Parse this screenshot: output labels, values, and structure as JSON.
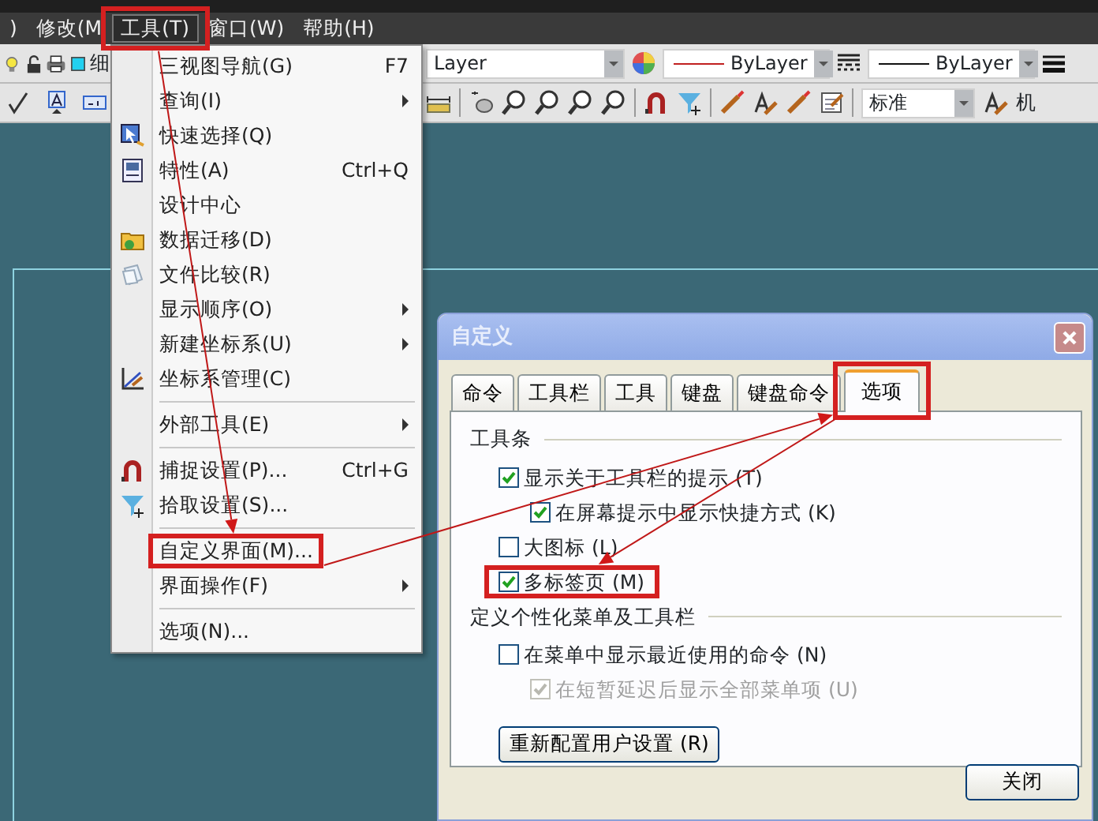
{
  "menubar": {
    "items": [
      {
        "label": ")",
        "selected": false,
        "highlighted": false
      },
      {
        "label": "修改(M",
        "selected": false,
        "highlighted": false
      },
      {
        "label": "工具(T)",
        "selected": true,
        "highlighted": true
      },
      {
        "label": "窗口(W)",
        "selected": false,
        "highlighted": false
      },
      {
        "label": "帮助(H)",
        "selected": false,
        "highlighted": false
      }
    ]
  },
  "toolbar_1": {
    "text_1": "细",
    "layer_combo": {
      "value": "Layer"
    },
    "linetype_combo": {
      "value": "ByLayer"
    },
    "lineweight_combo": {
      "value": "ByLayer"
    }
  },
  "toolbar_2": {
    "style_combo": {
      "value": "标准"
    },
    "text_2": "机"
  },
  "tools_menu": {
    "items": [
      {
        "kind": "item",
        "label": "三视图导航(G)",
        "shortcut": "F7",
        "submenu": false,
        "highlighted": false
      },
      {
        "kind": "item",
        "label": "查询(I)",
        "submenu": true,
        "highlighted": false
      },
      {
        "kind": "item",
        "label": "快速选择(Q)",
        "submenu": false,
        "highlighted": false
      },
      {
        "kind": "item",
        "label": "特性(A)",
        "shortcut": "Ctrl+Q",
        "submenu": false,
        "highlighted": false
      },
      {
        "kind": "item",
        "label": "设计中心",
        "submenu": false,
        "highlighted": false
      },
      {
        "kind": "item",
        "label": "数据迁移(D)",
        "submenu": false,
        "highlighted": false
      },
      {
        "kind": "item",
        "label": "文件比较(R)",
        "submenu": false,
        "highlighted": false
      },
      {
        "kind": "item",
        "label": "显示顺序(O)",
        "submenu": true,
        "highlighted": false
      },
      {
        "kind": "item",
        "label": "新建坐标系(U)",
        "submenu": true,
        "highlighted": false
      },
      {
        "kind": "item",
        "label": "坐标系管理(C)",
        "submenu": false,
        "highlighted": false
      },
      {
        "kind": "separator"
      },
      {
        "kind": "item",
        "label": "外部工具(E)",
        "submenu": true,
        "highlighted": false
      },
      {
        "kind": "separator"
      },
      {
        "kind": "item",
        "label": "捕捉设置(P)...",
        "shortcut": "Ctrl+G",
        "submenu": false,
        "highlighted": false
      },
      {
        "kind": "item",
        "label": "拾取设置(S)...",
        "submenu": false,
        "highlighted": false
      },
      {
        "kind": "separator"
      },
      {
        "kind": "item",
        "label": "自定义界面(M)...",
        "submenu": false,
        "highlighted": true
      },
      {
        "kind": "item",
        "label": "界面操作(F)",
        "submenu": true,
        "highlighted": false
      },
      {
        "kind": "separator"
      },
      {
        "kind": "item",
        "label": "选项(N)...",
        "submenu": false,
        "highlighted": false
      }
    ]
  },
  "dialog": {
    "title": "自定义",
    "tabs": [
      {
        "label": "命令",
        "selected": false,
        "highlighted": false
      },
      {
        "label": "工具栏",
        "selected": false,
        "highlighted": false
      },
      {
        "label": "工具",
        "selected": false,
        "highlighted": false
      },
      {
        "label": "键盘",
        "selected": false,
        "highlighted": false
      },
      {
        "label": "键盘命令",
        "selected": false,
        "highlighted": false
      },
      {
        "label": "选项",
        "selected": true,
        "highlighted": true
      }
    ],
    "groups": [
      {
        "title": "工具条",
        "options": [
          {
            "label": "显示关于工具栏的提示 (T)",
            "checked": true,
            "disabled": false,
            "highlighted": false,
            "children": [
              {
                "label": "在屏幕提示中显示快捷方式 (K)",
                "checked": true,
                "disabled": false,
                "highlighted": false
              }
            ]
          },
          {
            "label": "大图标 (L)",
            "checked": false,
            "disabled": false,
            "highlighted": false
          },
          {
            "label": "多标签页 (M)",
            "checked": true,
            "disabled": false,
            "highlighted": true
          }
        ]
      },
      {
        "title": "定义个性化菜单及工具栏",
        "options": [
          {
            "label": "在菜单中显示最近使用的命令 (N)",
            "checked": false,
            "disabled": false,
            "highlighted": false,
            "children": [
              {
                "label": "在短暂延迟后显示全部菜单项 (U)",
                "checked": true,
                "disabled": true,
                "highlighted": false
              }
            ]
          }
        ]
      }
    ],
    "reset_button": "重新配置用户设置 (R)",
    "close_button": "关闭"
  }
}
